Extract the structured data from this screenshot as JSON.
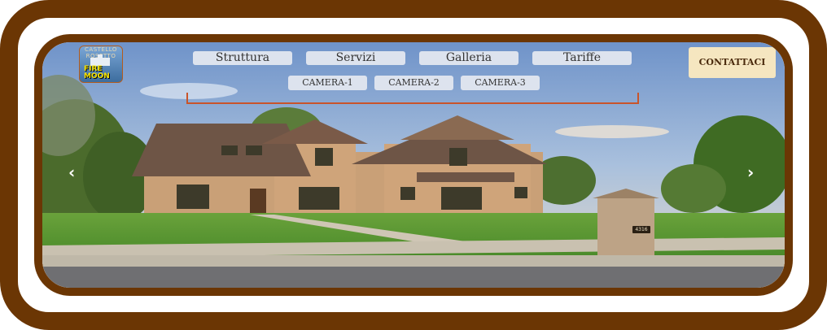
{
  "logo": {
    "top_text": "CASTELLO ROSETTO",
    "line1": "FIRE",
    "line2": "MOON"
  },
  "nav": {
    "items": [
      {
        "label": "Struttura"
      },
      {
        "label": "Servizi"
      },
      {
        "label": "Galleria"
      },
      {
        "label": "Tariffe"
      }
    ],
    "sub_items": [
      {
        "label": "CAMERA-1"
      },
      {
        "label": "CAMERA-2"
      },
      {
        "label": "CAMERA-3"
      }
    ],
    "contact_label": "CONTATTACI"
  },
  "slider": {
    "prev_icon": "‹",
    "next_icon": "›",
    "house_number": "4316"
  },
  "colors": {
    "frame": "#6b3604",
    "nav_button_bg": "#dde3ee",
    "contact_bg": "#f5e6c0",
    "accent_line": "#c9542a"
  }
}
